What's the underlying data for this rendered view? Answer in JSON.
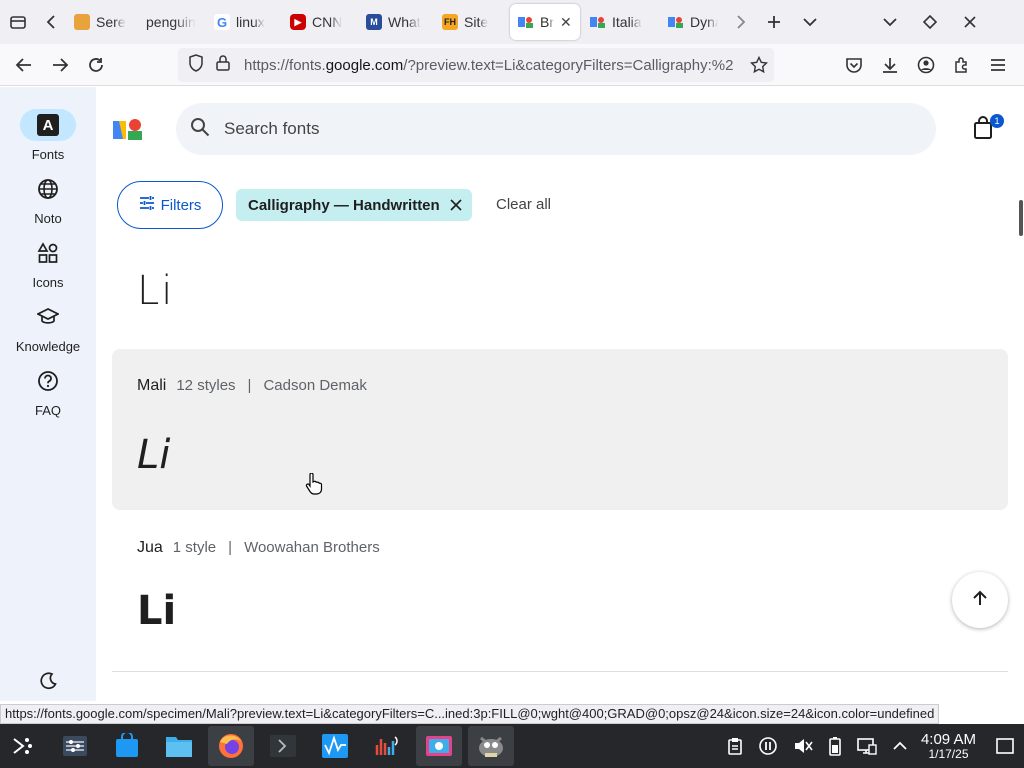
{
  "tabs": [
    {
      "label": "Serei",
      "favicon_color": "#e8a33c"
    },
    {
      "label": "penguin",
      "favicon_color": ""
    },
    {
      "label": "linux",
      "favicon_color": "#4285f4"
    },
    {
      "label": "CNN",
      "favicon_color": "#cc0000"
    },
    {
      "label": "What",
      "favicon_color": "#2a4d9b"
    },
    {
      "label": "Site",
      "favicon_color": "#f5a623"
    },
    {
      "label": "Br",
      "favicon_color": "#4285f4",
      "active": true
    },
    {
      "label": "Italia",
      "favicon_color": "#4285f4"
    },
    {
      "label": "Dyna",
      "favicon_color": "#4285f4"
    }
  ],
  "address": {
    "prefix": "https://fonts.",
    "host": "google.com",
    "suffix": "/?preview.text=Li&categoryFilters=Calligraphy:%2FS"
  },
  "rail": {
    "items": [
      {
        "label": "Fonts",
        "icon": "A"
      },
      {
        "label": "Noto",
        "icon": "globe"
      },
      {
        "label": "Icons",
        "icon": "shapes"
      },
      {
        "label": "Knowledge",
        "icon": "school"
      },
      {
        "label": "FAQ",
        "icon": "help"
      }
    ]
  },
  "search": {
    "placeholder": "Search fonts"
  },
  "cart": {
    "count": "1"
  },
  "filters": {
    "button": "Filters",
    "chip": "Calligraphy — Handwritten",
    "clear": "Clear all"
  },
  "results": [
    {
      "sample": "Li"
    },
    {
      "name": "Mali",
      "styles": "12 styles",
      "designer": "Cadson Demak",
      "sample": "Li"
    },
    {
      "name": "Jua",
      "styles": "1 style",
      "designer": "Woowahan Brothers",
      "sample": "Li"
    }
  ],
  "status_url": "https://fonts.google.com/specimen/Mali?preview.text=Li&categoryFilters=C...ined:3p:FILL@0;wght@400;GRAD@0;opsz@24&icon.size=24&icon.color=undefined",
  "clock": {
    "time": "4:09 AM",
    "date": "1/17/25"
  }
}
